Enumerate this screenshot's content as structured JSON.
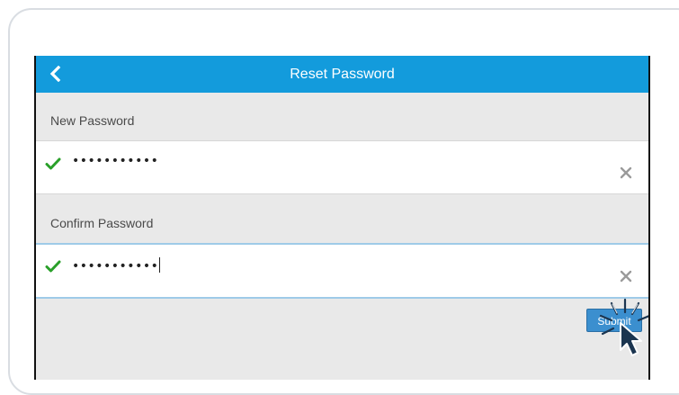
{
  "header": {
    "title": "Reset Password",
    "back_icon": "chevron-left-icon",
    "color": "#139bdc"
  },
  "new_password": {
    "label": "New Password",
    "value": "•••••••••••",
    "status_icon": "check-icon",
    "clear_icon": "close-icon"
  },
  "confirm_password": {
    "label": "Confirm Password",
    "value": "•••••••••••",
    "status_icon": "check-icon",
    "clear_icon": "close-icon"
  },
  "submit": {
    "label": "Submit",
    "color": "#3b8fcf"
  },
  "colors": {
    "success": "#2aa02a",
    "background": "#e9e9e9"
  }
}
